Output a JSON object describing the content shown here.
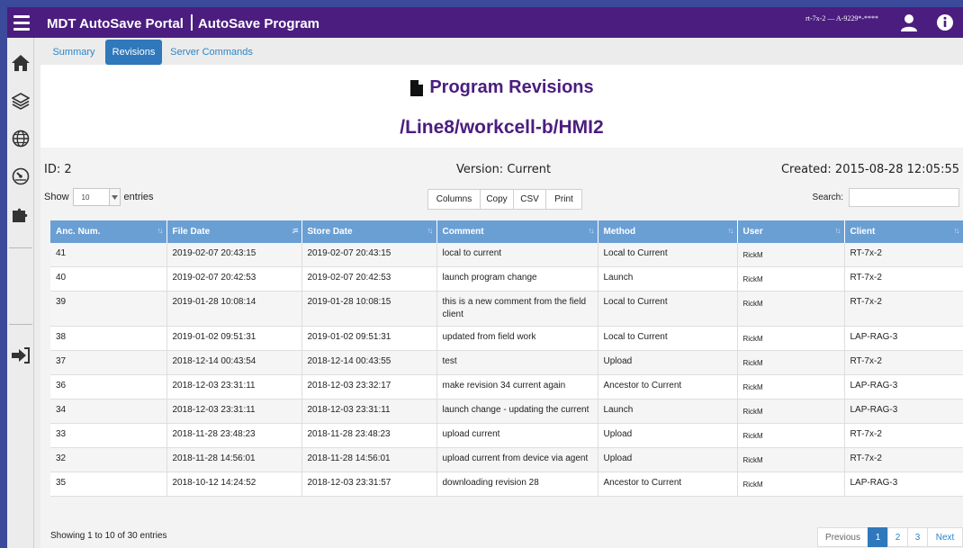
{
  "header": {
    "app_name": "MDT AutoSave Portal",
    "section": "AutoSave Program",
    "user_info": "rt-7x-2 — A-9229*-****"
  },
  "tabs": [
    {
      "label": "Summary",
      "active": false
    },
    {
      "label": "Revisions",
      "active": true
    },
    {
      "label": "Server Commands",
      "active": false
    }
  ],
  "page": {
    "title": "Program Revisions",
    "path": "/Line8/workcell-b/HMI2"
  },
  "info": {
    "id": "ID: 2",
    "version": "Version: Current",
    "created": "Created: 2015-08-28 12:05:55"
  },
  "controls": {
    "show_label": "Show",
    "page_size": "10",
    "entries_label": "entries",
    "buttons": [
      "Columns",
      "Copy",
      "CSV",
      "Print"
    ],
    "search_label": "Search:",
    "search_value": ""
  },
  "table": {
    "columns": [
      "Anc. Num.",
      "File Date",
      "Store Date",
      "Comment",
      "Method",
      "User",
      "Client"
    ],
    "rows": [
      [
        "41",
        "2019-02-07 20:43:15",
        "2019-02-07 20:43:15",
        "local to current",
        "Local to Current",
        "RickM",
        "RT-7x-2"
      ],
      [
        "40",
        "2019-02-07 20:42:53",
        "2019-02-07 20:42:53",
        "launch program change",
        "Launch",
        "RickM",
        "RT-7x-2"
      ],
      [
        "39",
        "2019-01-28 10:08:14",
        "2019-01-28 10:08:15",
        "this is a new comment from the field client",
        "Local to Current",
        "RickM",
        "RT-7x-2"
      ],
      [
        "38",
        "2019-01-02 09:51:31",
        "2019-01-02 09:51:31",
        "updated from field work",
        "Local to Current",
        "RickM",
        "LAP-RAG-3"
      ],
      [
        "37",
        "2018-12-14 00:43:54",
        "2018-12-14 00:43:55",
        "test",
        "Upload",
        "RickM",
        "RT-7x-2"
      ],
      [
        "36",
        "2018-12-03 23:31:11",
        "2018-12-03 23:32:17",
        "make revision 34 current again",
        "Ancestor to Current",
        "RickM",
        "LAP-RAG-3"
      ],
      [
        "34",
        "2018-12-03 23:31:11",
        "2018-12-03 23:31:11",
        "launch change - updating the current",
        "Launch",
        "RickM",
        "LAP-RAG-3"
      ],
      [
        "33",
        "2018-11-28 23:48:23",
        "2018-11-28 23:48:23",
        "upload current",
        "Upload",
        "RickM",
        "RT-7x-2"
      ],
      [
        "32",
        "2018-11-28 14:56:01",
        "2018-11-28 14:56:01",
        "upload current from device via agent",
        "Upload",
        "RickM",
        "RT-7x-2"
      ],
      [
        "35",
        "2018-10-12 14:24:52",
        "2018-12-03 23:31:57",
        "downloading revision 28",
        "Ancestor to Current",
        "RickM",
        "LAP-RAG-3"
      ]
    ]
  },
  "footer": {
    "summary": "Showing 1 to 10 of 30 entries",
    "pagination": {
      "previous": "Previous",
      "pages": [
        "1",
        "2",
        "3"
      ],
      "active_page": "1",
      "next": "Next"
    }
  },
  "icons": {
    "top": [
      "hamburger-icon",
      "user-icon",
      "info-icon"
    ],
    "sidebar": [
      "home-icon",
      "layers-icon",
      "globe-icon",
      "gauge-icon",
      "puzzle-icon",
      "logout-icon"
    ],
    "title": "document-icon"
  },
  "colors": {
    "header_bg": "#4b1d7f",
    "accent": "#2f78bb",
    "table_header": "#6a9fd4",
    "title_text": "#4b1d7f"
  }
}
